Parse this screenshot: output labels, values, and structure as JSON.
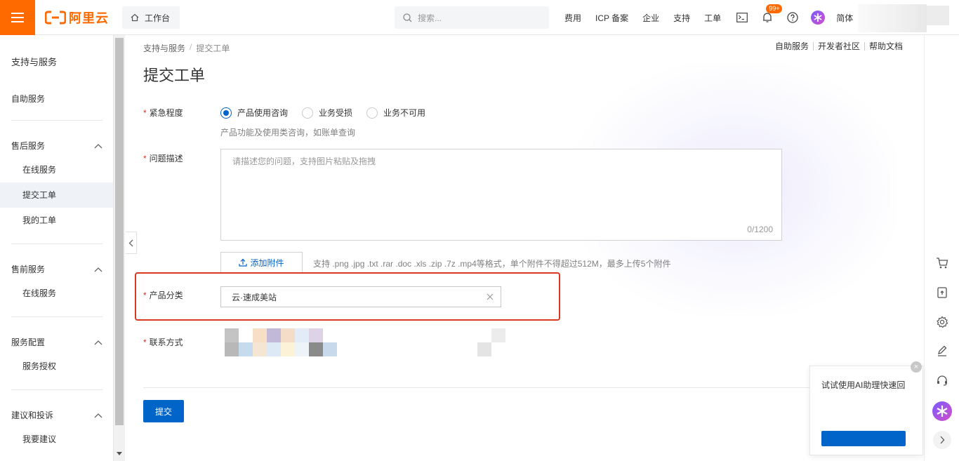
{
  "header": {
    "logo_text": "阿里云",
    "workbench_label": "工作台",
    "search_placeholder": "搜索...",
    "nav_links": [
      "费用",
      "ICP 备案",
      "企业",
      "支持",
      "工单"
    ],
    "notification_badge": "99+",
    "language": "简体"
  },
  "sidebar": {
    "title": "支持与服务",
    "self_service": "自助服务",
    "groups": [
      {
        "label": "售后服务",
        "items": [
          "在线服务",
          "提交工单",
          "我的工单"
        ]
      },
      {
        "label": "售前服务",
        "items": [
          "在线服务"
        ]
      },
      {
        "label": "服务配置",
        "items": [
          "服务授权"
        ]
      },
      {
        "label": "建议和投诉",
        "items": [
          "我要建议"
        ]
      }
    ],
    "active_item": "提交工单"
  },
  "breadcrumb": {
    "parent": "支持与服务",
    "separator": "/",
    "current": "提交工单"
  },
  "top_links": [
    "自助服务",
    "开发者社区",
    "帮助文档"
  ],
  "page_title": "提交工单",
  "form": {
    "urgency": {
      "label": "紧急程度",
      "options": [
        "产品使用咨询",
        "业务受损",
        "业务不可用"
      ],
      "selected": "产品使用咨询",
      "hint": "产品功能及使用类咨询，如账单查询"
    },
    "description": {
      "label": "问题描述",
      "placeholder": "请描述您的问题，支持图片粘贴及拖拽",
      "counter": "0/1200"
    },
    "attachment": {
      "button_label": "添加附件",
      "hint": "支持 .png .jpg .txt .rar .doc .xls .zip .7z .mp4等格式，单个附件不得超过512M，最多上传5个附件"
    },
    "product_category": {
      "label": "产品分类",
      "value": "云·速成美站"
    },
    "contact": {
      "label": "联系方式"
    },
    "submit_label": "提交",
    "required_mark": "*"
  },
  "ai_popup": {
    "text": "试试使用AI助理快速回"
  },
  "colors": {
    "brand_orange": "#ff6a00",
    "primary_blue": "#0064c8",
    "highlight_red": "#d9391e"
  }
}
